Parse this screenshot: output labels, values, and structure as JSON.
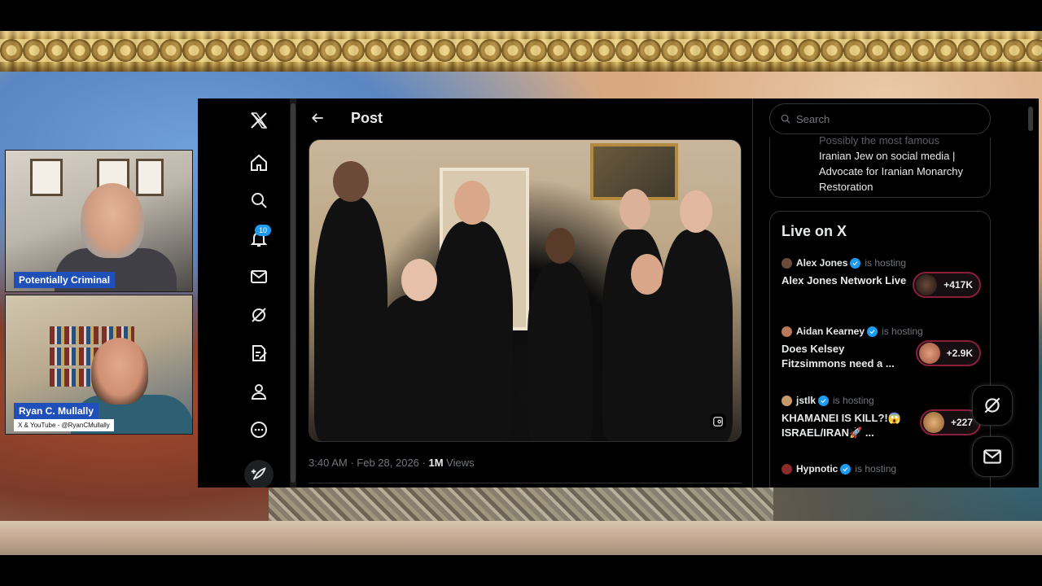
{
  "webcams": [
    {
      "name": "Potentially Criminal"
    },
    {
      "name": "Ryan C. Mullally",
      "subtitle": "X & YouTube - @RyanCMullally"
    }
  ],
  "nav": {
    "logo": "X",
    "items": [
      "home-icon",
      "search-icon",
      "bell-icon",
      "mail-icon",
      "grok-icon",
      "pages-icon",
      "profile-icon",
      "more-icon"
    ],
    "notification_count": "10"
  },
  "post": {
    "header_title": "Post",
    "time": "3:40 AM",
    "date": "Feb 28, 2026",
    "views_count": "1M",
    "views_label": "Views"
  },
  "sidebar": {
    "search_placeholder": "Search",
    "bio_faded": "Possibly the most famous",
    "bio_lines": "Iranian Jew on social media | Advocate for Iranian Monarchy Restoration",
    "live": {
      "title": "Live on X",
      "hosting_label": "is hosting",
      "spaces": [
        {
          "host": "Alex Jones",
          "topic": "Alex Jones Network Live",
          "count": "+417K",
          "avatar_color": "#6b4a3a"
        },
        {
          "host": "Aidan Kearney",
          "topic": "Does Kelsey Fitzsimmons need a ...",
          "count": "+2.9K",
          "avatar_color": "#b87a5a"
        },
        {
          "host": "jstlk",
          "topic": "KHAMANEI IS KILL?!😱 ISRAEL/IRAN🚀 ...",
          "count": "+227",
          "avatar_color": "#c69a6a"
        },
        {
          "host": "Hypnotic",
          "topic": "",
          "count": "",
          "avatar_color": "#8a2a2a"
        }
      ]
    }
  },
  "colors": {
    "accent": "#1d9bf0",
    "background": "#000000",
    "text": "#e7e9ea",
    "muted": "#71767b",
    "border": "#2f3336",
    "live_border": "#8a1f3b",
    "name_tag": "#1f4fb8"
  }
}
